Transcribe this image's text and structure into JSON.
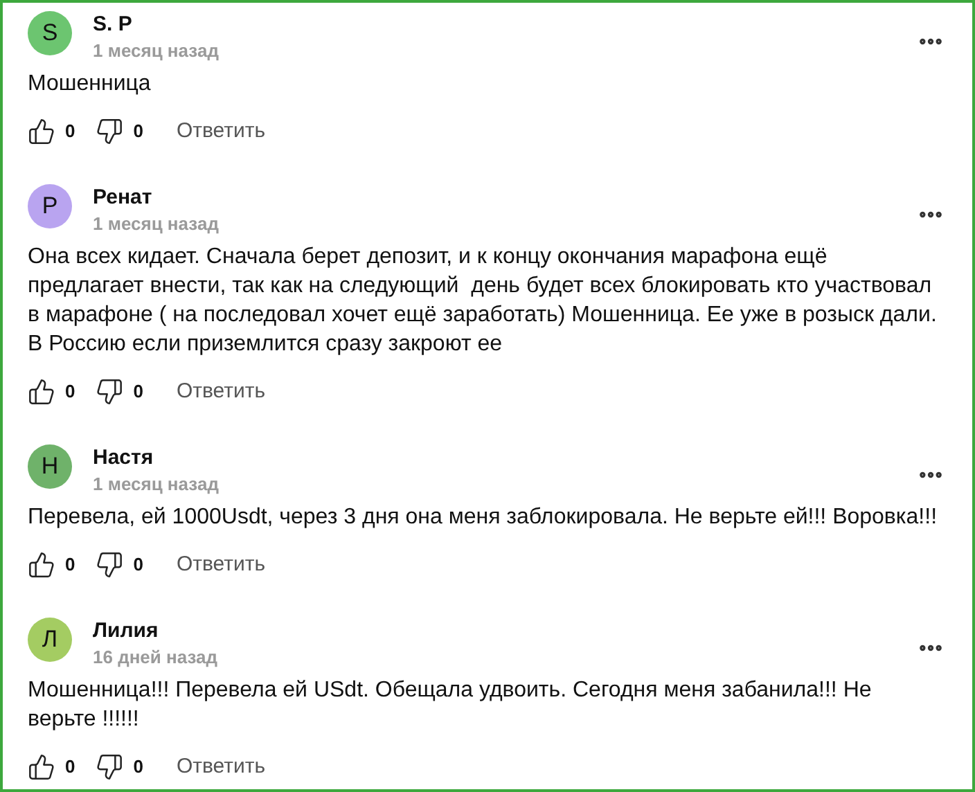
{
  "comments": [
    {
      "avatar": "S",
      "color": "#6cc570",
      "name": "S. P",
      "date": "1 месяц назад",
      "text": "Мошенница",
      "likes": "0",
      "dislikes": "0",
      "reply": "Ответить"
    },
    {
      "avatar": "Р",
      "color": "#b9a4f0",
      "name": "Ренат",
      "date": "1 месяц назад",
      "text": "Она всех кидает. Сначала берет депозит, и к концу окончания марафона ещё предлагает внести, так как на следующий  день будет всех блокировать кто участвовал в марафоне ( на последовал хочет ещё заработать) Мошенница. Ее уже в розыск дали. В Россию если приземлится сразу закроют ее",
      "likes": "0",
      "dislikes": "0",
      "reply": "Ответить"
    },
    {
      "avatar": "Н",
      "color": "#6fb26a",
      "name": "Настя",
      "date": "1 месяц назад",
      "text": "Перевела, ей 1000Usdt, через 3 дня она меня заблокировала. Не верьте ей!!! Воровка!!!",
      "likes": "0",
      "dislikes": "0",
      "reply": "Ответить"
    },
    {
      "avatar": "Л",
      "color": "#a4cc62",
      "name": "Лилия",
      "date": "16 дней назад",
      "text": "Мошенница!!! Перевела ей USdt. Обещала удвоить. Сегодня меня забанила!!! Не верьте !!!!!!",
      "likes": "0",
      "dislikes": "0",
      "reply": "Ответить"
    }
  ]
}
